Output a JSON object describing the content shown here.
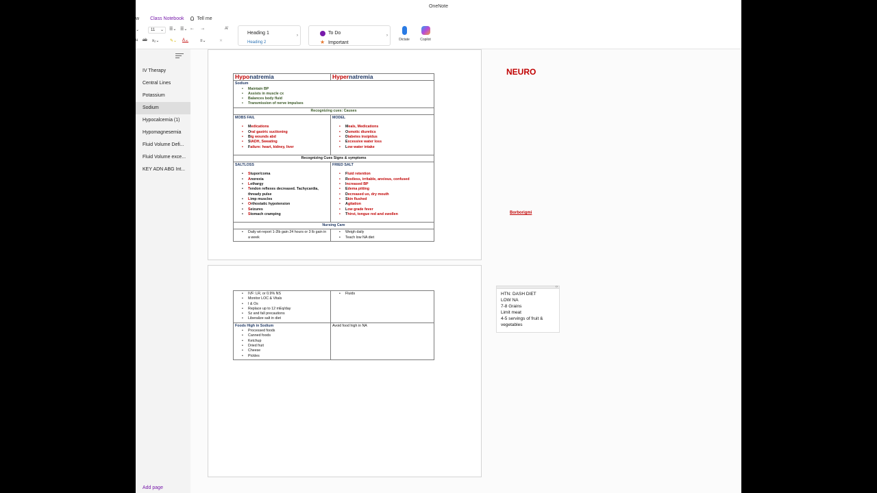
{
  "app": {
    "title": "OneNote"
  },
  "tabs": [
    "w",
    "Class Notebook"
  ],
  "tellme": "Tell me",
  "ribbon": {
    "font_size": "11",
    "styles": {
      "h1": "Heading 1",
      "h2": "Heading 2"
    },
    "tags": {
      "todo": "To Do",
      "important": "Important"
    },
    "dictate": "Dictate",
    "copilot": "Copilot"
  },
  "colors": {
    "accent": "#7719aa",
    "red": "#c00000",
    "navy": "#1f3864",
    "green": "#375623"
  },
  "sidebar": {
    "pages": [
      "IV Therapy",
      "Central Lines",
      "Potassium",
      "Sodium",
      "Hypocalcemia (1)",
      "Hypomagnesemia",
      "Fluid Volume Defi...",
      "Fluid Volume exce...",
      "KEY ADN ABG Int..."
    ],
    "add_page": "Add page"
  },
  "note": {
    "neuro": "NEURO",
    "borborigmi": "Borborigmi",
    "box_lines": [
      "HTN: DASH DIET",
      "LOW NA",
      "7-8 Grains",
      "Limit meat",
      "4-5 servings of fruit &",
      "vegetables"
    ]
  },
  "table1": {
    "hypo": {
      "prefix": "Hypo",
      "suffix": "natremia"
    },
    "hyper": {
      "prefix": "Hyper",
      "suffix": "natremia"
    },
    "sodium": {
      "title": "Sodium",
      "items": [
        "Maintain BP",
        "Assists in muscle cx",
        "Balances body fluid",
        "Transmission of nerve impulses"
      ]
    },
    "causes_header": "Recognizing cues: Causes",
    "mobsfail": {
      "title": "MOBS FAIL",
      "items": [
        {
          "f": "M",
          "r": "edications"
        },
        {
          "f": "O",
          "r": "ral gastric suctioning"
        },
        {
          "f": "B",
          "r": "ig wounds abd"
        },
        {
          "f": "S",
          "r": "IADH, Sweating"
        },
        {
          "f": "F",
          "r": "ailure: heart, kidney, liver"
        }
      ]
    },
    "model": {
      "title": "MODEL",
      "items": [
        {
          "f": "M",
          "r": "eals, Medications"
        },
        {
          "f": "O",
          "r": "smotic diuretics"
        },
        {
          "f": "D",
          "r": "iabetes insipidus"
        },
        {
          "f": "E",
          "r": "xcessive water loss"
        },
        {
          "f": "L",
          "r": "ow water intake"
        }
      ]
    },
    "signs_header": "Recognizing Cues Signs & symptoms",
    "saltloss": {
      "title": "SALTLOSS",
      "items": [
        {
          "f": "S",
          "r": "tupor/coma"
        },
        {
          "f": "A",
          "r": "norexia"
        },
        {
          "f": "L",
          "r": "ethargy"
        },
        {
          "f": "T",
          "r": "endon reflexes decreased. Tachycardia, thready pulse"
        },
        {
          "f": "L",
          "r": "imp muscles"
        },
        {
          "f": "O",
          "r": "rthostatic hypotension"
        },
        {
          "f": "S",
          "r": "eizures"
        },
        {
          "f": "S",
          "r": "tomach cramping"
        }
      ]
    },
    "friedsalt": {
      "title": "FRIED SALT",
      "items": [
        {
          "f": "F",
          "r": "luid retention"
        },
        {
          "f": "R",
          "r": "estless, irritable, anxious, confused"
        },
        {
          "f": "I",
          "r": "ncreased BP"
        },
        {
          "f": "E",
          "r": "dema pitting"
        },
        {
          "f": "D",
          "r": "ecreased uo, dry mouth"
        },
        {
          "f": "S",
          "r": "kin flushed"
        },
        {
          "f": "A",
          "r": "gitation"
        },
        {
          "f": "L",
          "r": "ow grade fever"
        },
        {
          "f": "T",
          "r": "hirst, tongue red and swollen"
        }
      ]
    },
    "nursing_header": "Nursing Care",
    "nursing_left": [
      "Daily wt-report 1-2lb gain 24 hours or 3 lb gain in a week"
    ],
    "nursing_right": [
      "Weigh daily",
      "Teach low NA diet"
    ]
  },
  "table2": {
    "left_items": [
      "IVF: LR, or 0.9% NS",
      "Monitor LOC & Vitals",
      "I & Os",
      "Replace up to 12 mEq/day",
      "Sz and fall precautions",
      "Liberalize salt in diet"
    ],
    "right_items": [
      "Fluids"
    ],
    "foods_title": "Foods High in Sodium",
    "foods_items": [
      "Processed foods",
      "Canned foods",
      "Ketchup",
      "Dried fruit",
      "Cheese",
      "Pickles"
    ],
    "avoid": "Avoid food high in NA"
  }
}
